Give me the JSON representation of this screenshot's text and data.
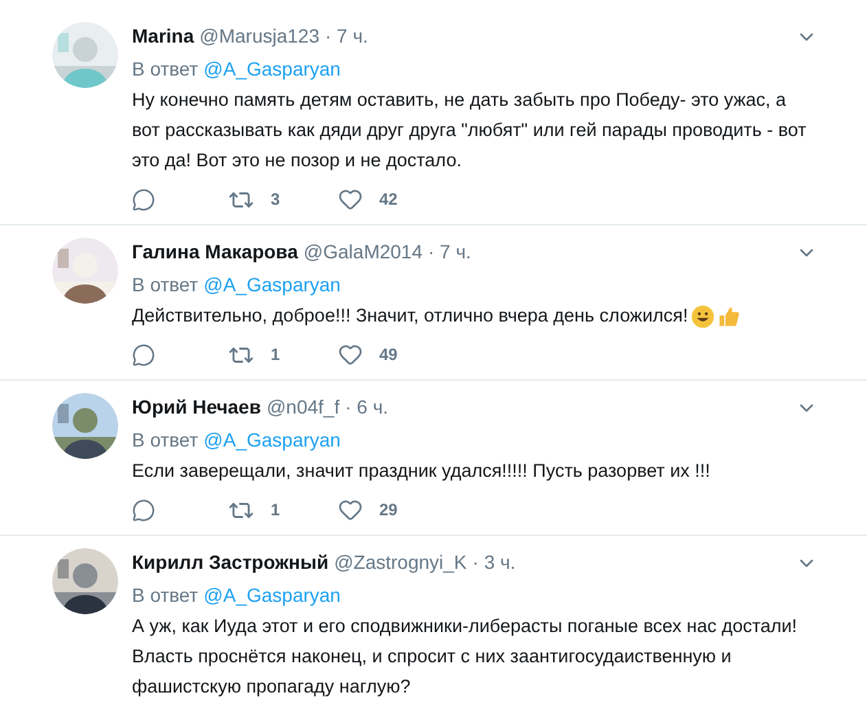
{
  "tweets": [
    {
      "name": "Marina",
      "handle": "@Marusja123",
      "time": "· 7 ч.",
      "reply_prefix": "В ответ",
      "reply_to": "@A_Gasparyan",
      "text": "Ну конечно память детям оставить, не дать забыть про Победу- это ужас, а вот рассказывать как дяди друг друга \"любят\" или гей парады проводить - вот это да! Вот это не позор и не достало.",
      "emoji": false,
      "retweets": "3",
      "likes": "42"
    },
    {
      "name": "Галина Макарова",
      "handle": "@GalaM2014",
      "time": "· 7 ч.",
      "reply_prefix": "В ответ",
      "reply_to": "@A_Gasparyan",
      "text": "Действительно, доброе!!! Значит, отлично вчера день сложился!",
      "emoji": true,
      "retweets": "1",
      "likes": "49"
    },
    {
      "name": "Юрий Нечаев",
      "handle": "@n04f_f",
      "time": "· 6 ч.",
      "reply_prefix": "В ответ",
      "reply_to": "@A_Gasparyan",
      "text": "Если заверещали, значит праздник удался!!!!! Пусть разорвет их !!!",
      "emoji": false,
      "retweets": "1",
      "likes": "29"
    },
    {
      "name": "Кирилл Застрожный",
      "handle": "@Zastrognyi_K",
      "time": "· 3 ч.",
      "reply_prefix": "В ответ",
      "reply_to": "@A_Gasparyan",
      "text": "А уж, как Иуда этот и его сподвижники-либерасты поганые всех нас достали! Власть проснётся наконец, и спросит с них заантигосудаиственную и фашистскую пропагаду наглую?",
      "emoji": false
    }
  ]
}
